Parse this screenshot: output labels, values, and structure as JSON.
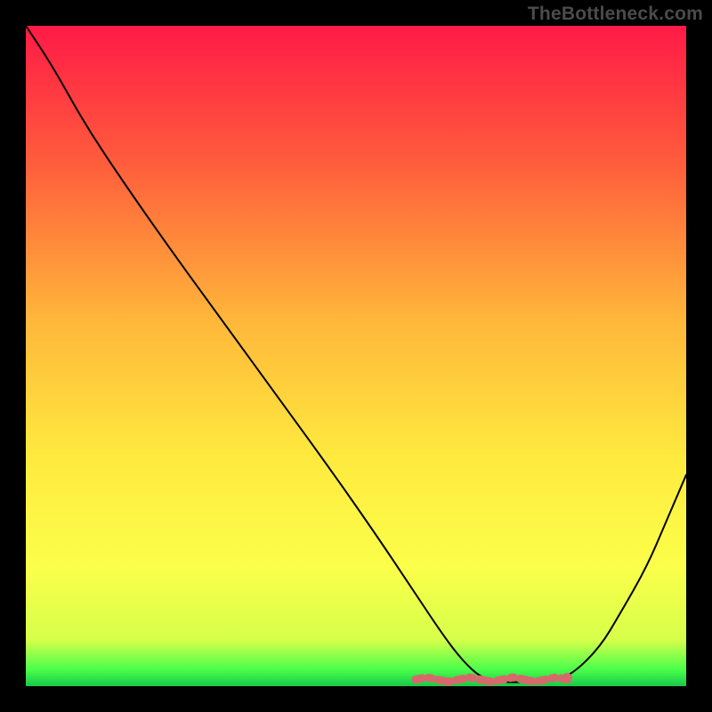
{
  "watermark": "TheBottleneck.com",
  "gradient": {
    "stops": [
      {
        "offset": 0.0,
        "color": "#ff1a47"
      },
      {
        "offset": 0.2,
        "color": "#ff5a3c"
      },
      {
        "offset": 0.45,
        "color": "#ffb83a"
      },
      {
        "offset": 0.65,
        "color": "#ffe93e"
      },
      {
        "offset": 0.82,
        "color": "#fbff4a"
      },
      {
        "offset": 0.93,
        "color": "#d6ff4a"
      },
      {
        "offset": 0.975,
        "color": "#4aff4a"
      },
      {
        "offset": 1.0,
        "color": "#18c74a"
      }
    ]
  },
  "chart_data": {
    "type": "line",
    "title": "",
    "xlabel": "",
    "ylabel": "",
    "xlim": [
      0,
      100
    ],
    "ylim": [
      0,
      100
    ],
    "series": [
      {
        "name": "curve",
        "x": [
          0,
          4,
          9,
          15,
          22,
          30,
          38,
          46,
          53,
          59,
          63,
          66,
          69,
          72,
          76,
          80,
          83,
          87,
          90,
          94,
          97,
          100
        ],
        "y": [
          100,
          94,
          85,
          76,
          66,
          55,
          44,
          33,
          23,
          14,
          8,
          4,
          1.2,
          0.6,
          0.6,
          0.8,
          2,
          6,
          11,
          18,
          25,
          32
        ]
      }
    ],
    "ground_band": {
      "x0": 59,
      "x1": 82,
      "y": 1.0
    },
    "annotations": []
  }
}
